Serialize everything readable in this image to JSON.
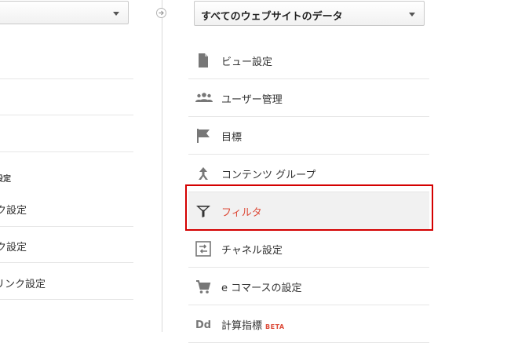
{
  "left_column": {
    "items": [
      {
        "label": "ク設定"
      },
      {
        "label": "ク設定"
      },
      {
        "label": "リンク設定"
      }
    ],
    "section_heading": "設定"
  },
  "view_selector": {
    "selected": "すべてのウェブサイトのデータ"
  },
  "menu": {
    "items": [
      {
        "label": "ビュー設定",
        "icon": "document-icon"
      },
      {
        "label": "ユーザー管理",
        "icon": "users-icon"
      },
      {
        "label": "目標",
        "icon": "flag-icon"
      },
      {
        "label": "コンテンツ グループ",
        "icon": "content-grouping-icon"
      },
      {
        "label": "フィルタ",
        "icon": "filter-icon",
        "active": true
      },
      {
        "label": "チャネル設定",
        "icon": "channel-settings-icon"
      },
      {
        "label": "e コマースの設定",
        "icon": "cart-icon"
      },
      {
        "label": "計算指標",
        "icon": "dd-icon",
        "badge": "BETA"
      }
    ]
  },
  "colors": {
    "active_text": "#dd4b39",
    "highlight_border": "#d40000"
  }
}
